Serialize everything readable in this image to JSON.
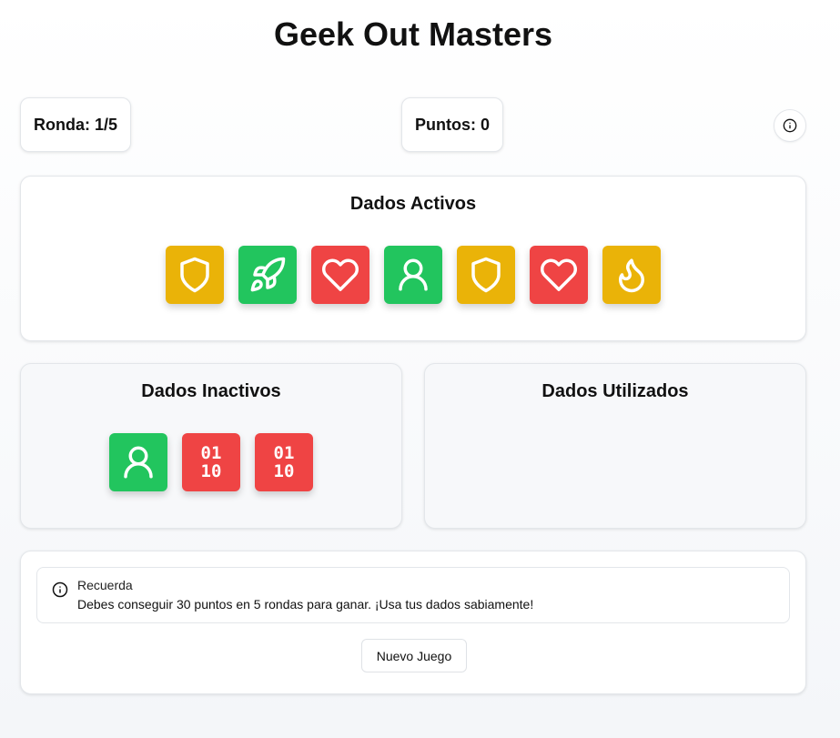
{
  "title": "Geek Out Masters",
  "stats": {
    "round_label": "Ronda: 1/5",
    "points_label": "Puntos: 0"
  },
  "info_button_icon": "info-icon",
  "colors": {
    "yellow": "#eab308",
    "green": "#22c55e",
    "red": "#ef4444"
  },
  "active_dice": {
    "title": "Dados Activos",
    "dice": [
      {
        "face": "shield",
        "color": "yellow"
      },
      {
        "face": "rocket",
        "color": "green"
      },
      {
        "face": "heart",
        "color": "red"
      },
      {
        "face": "person",
        "color": "green"
      },
      {
        "face": "shield",
        "color": "yellow"
      },
      {
        "face": "heart",
        "color": "red"
      },
      {
        "face": "flame",
        "color": "yellow"
      }
    ]
  },
  "inactive_dice": {
    "title": "Dados Inactivos",
    "dice": [
      {
        "face": "person",
        "color": "green"
      },
      {
        "face": "binary",
        "color": "red",
        "text": [
          "01",
          "10"
        ]
      },
      {
        "face": "binary",
        "color": "red",
        "text": [
          "01",
          "10"
        ]
      }
    ]
  },
  "used_dice": {
    "title": "Dados Utilizados",
    "dice": []
  },
  "notice": {
    "icon": "info-icon",
    "title": "Recuerda",
    "text": "Debes conseguir 30 puntos en 5 rondas para ganar. ¡Usa tus dados sabiamente!"
  },
  "new_game_label": "Nuevo Juego"
}
